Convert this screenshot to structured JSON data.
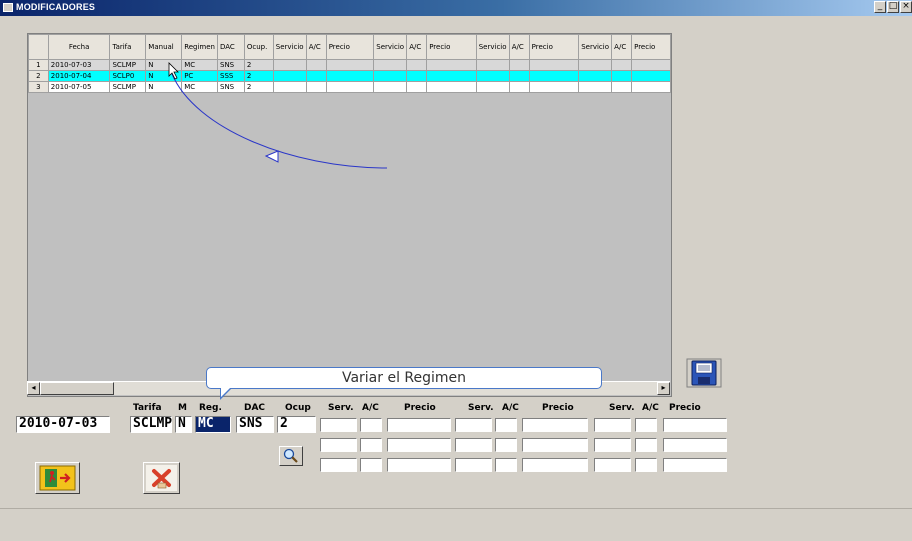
{
  "window": {
    "title": "MODIFICADORES"
  },
  "grid": {
    "headers": [
      "",
      "Fecha",
      "Tarifa",
      "Manual",
      "Regimen",
      "DAC",
      "Ocup.",
      "Servicio",
      "A/C",
      "Precio",
      "Servicio",
      "A/C",
      "Precio",
      "Servicio",
      "A/C",
      "Precio",
      "Servicio",
      "A/C",
      "Precio"
    ],
    "rows": [
      {
        "n": "1",
        "fecha": "2010-07-03",
        "tarifa": "SCLMP",
        "manual": "N",
        "regimen": "MC",
        "dac": "SNS",
        "ocup": "2"
      },
      {
        "n": "2",
        "fecha": "2010-07-04",
        "tarifa": "SCLP0",
        "manual": "N",
        "regimen": "PC",
        "dac": "SSS",
        "ocup": "2"
      },
      {
        "n": "3",
        "fecha": "2010-07-05",
        "tarifa": "SCLMP",
        "manual": "N",
        "regimen": "MC",
        "dac": "SNS",
        "ocup": "2"
      }
    ]
  },
  "tooltip": {
    "text": "Variar el Regimen"
  },
  "form": {
    "labels": {
      "tarifa": "Tarifa",
      "m": "M",
      "reg": "Reg.",
      "dac": "DAC",
      "ocup": "Ocup",
      "serv": "Serv.",
      "ac": "A/C",
      "precio": "Precio"
    },
    "values": {
      "fecha": "2010-07-03",
      "tarifa": "SCLMP",
      "m": "N",
      "reg": "MC",
      "dac": "SNS",
      "ocup": "2"
    }
  },
  "icons": {
    "save": "floppy-disk-icon",
    "search": "magnifier-icon",
    "exit": "exit-door-icon",
    "cancel": "cancel-x-icon"
  },
  "colors": {
    "selected_row": "#00ffff",
    "titlebar": "#0a246a",
    "annotation": "#2a36c8"
  }
}
